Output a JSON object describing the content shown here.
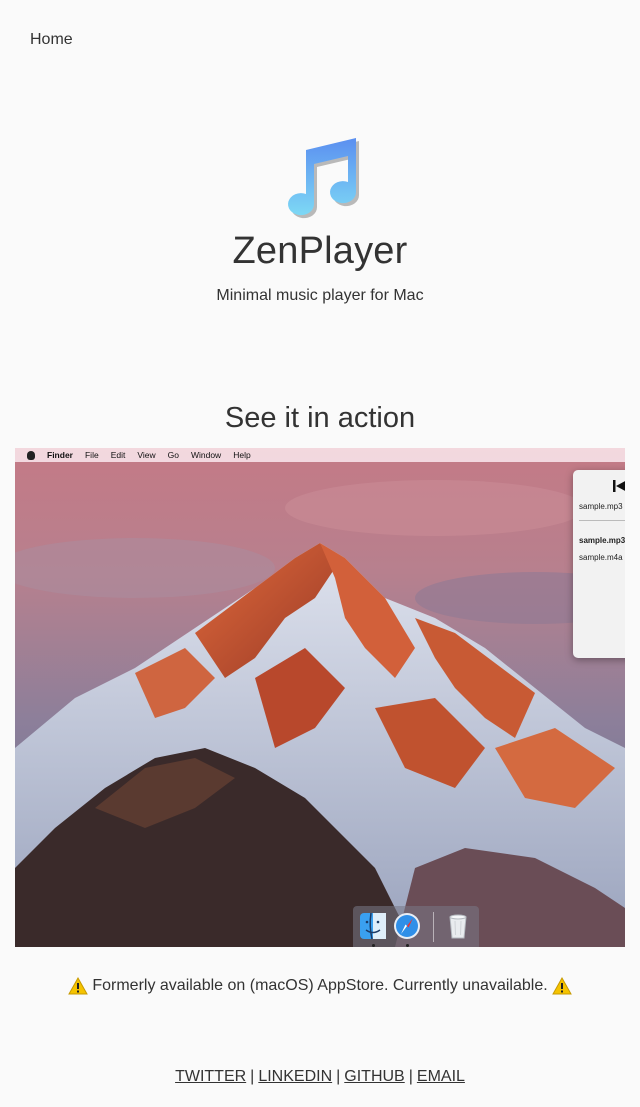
{
  "nav": {
    "home_label": "Home"
  },
  "hero": {
    "title": "ZenPlayer",
    "subtitle": "Minimal music player for Mac",
    "icon": "music-note-icon",
    "icon_color": "#5aa8f0"
  },
  "section": {
    "title": "See it in action"
  },
  "screenshot": {
    "menubar": [
      "Finder",
      "File",
      "Edit",
      "View",
      "Go",
      "Window",
      "Help"
    ],
    "player_tracks": [
      "sample.mp3",
      "sample.mp3",
      "sample.m4a"
    ],
    "dock_items": [
      "finder-icon",
      "safari-icon",
      "trash-icon"
    ]
  },
  "notice": {
    "text": "Formerly available on (macOS) AppStore. Currently unavailable.",
    "icon": "warning-icon"
  },
  "footer": {
    "links": [
      "TWITTER",
      "LINKEDIN",
      "GITHUB",
      "EMAIL"
    ],
    "separator": "|"
  }
}
